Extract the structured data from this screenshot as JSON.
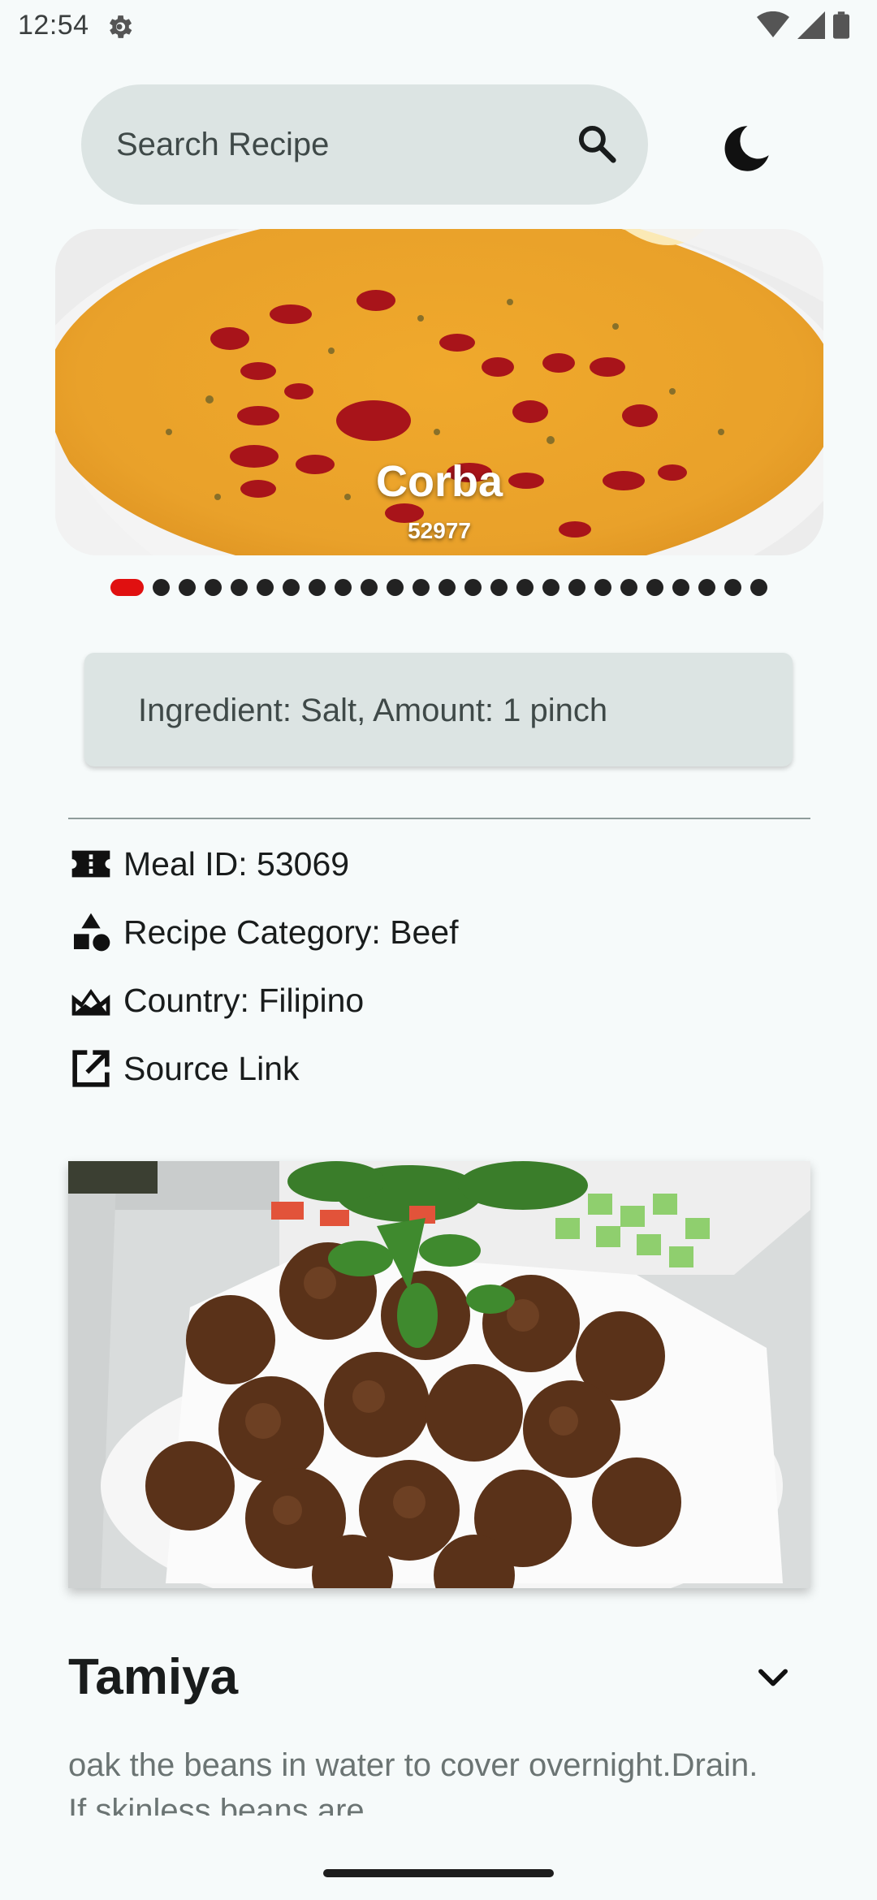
{
  "status_bar": {
    "time": "12:54",
    "icons": [
      "settings-gear-icon",
      "wifi-icon",
      "cellular-signal-icon",
      "battery-icon"
    ]
  },
  "search": {
    "placeholder": "Search Recipe",
    "search_icon": "search-icon",
    "theme_toggle_icon": "dark-mode-moon-icon"
  },
  "carousel": {
    "title": "Corba",
    "id": "52977",
    "total_pages": 25,
    "active_page": 1,
    "active_color": "#e01010"
  },
  "ingredient": {
    "text": "Ingredient: Salt, Amount: 1 pinch"
  },
  "details": {
    "meal_id": "Meal ID: 53069",
    "category": "Recipe Category: Beef",
    "country": "Country: Filipino",
    "source": "Source Link"
  },
  "meal": {
    "title": "Tamiya",
    "instructions": "oak the beans in water to cover overnight.Drain. If skinless beans are"
  }
}
